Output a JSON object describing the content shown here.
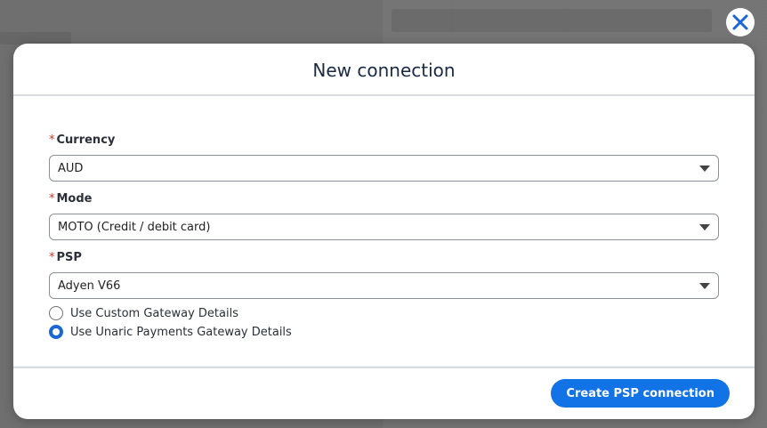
{
  "modal": {
    "title": "New connection",
    "fields": {
      "currency": {
        "required_mark": "*",
        "label": "Currency",
        "value": "AUD"
      },
      "mode": {
        "required_mark": "*",
        "label": "Mode",
        "value": "MOTO (Credit / debit card)"
      },
      "psp": {
        "required_mark": "*",
        "label": "PSP",
        "value": "Adyen V66"
      }
    },
    "gateway_options": [
      {
        "label": "Use Custom Gateway Details",
        "checked": false
      },
      {
        "label": "Use Unaric Payments Gateway Details",
        "checked": true
      }
    ],
    "footer": {
      "primary_label": "Create PSP connection"
    }
  },
  "icons": {
    "close": "close-icon",
    "caret": "chevron-down-icon"
  },
  "colors": {
    "accent": "#1273e6",
    "required": "#c23934",
    "close_icon": "#1a66d6"
  }
}
